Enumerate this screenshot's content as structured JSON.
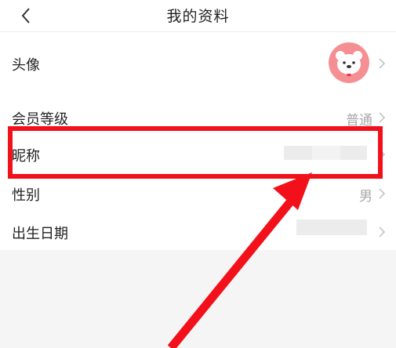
{
  "header": {
    "back_icon": "chevron-left-icon",
    "title": "我的资料"
  },
  "profile": {
    "rows": [
      {
        "label": "头像",
        "value": "",
        "icon": "avatar-bear-icon"
      },
      {
        "label": "会员等级",
        "value": "普通"
      },
      {
        "label": "昵称",
        "value": ""
      },
      {
        "label": "性别",
        "value": "男"
      },
      {
        "label": "出生日期",
        "value": ""
      }
    ],
    "chevron_icon": "chevron-right-icon"
  },
  "annotation": {
    "highlight_color": "#f2111a",
    "arrow_color": "#f2111a"
  },
  "colors": {
    "avatar_bg": "#f58f93",
    "page_bg": "#f5f5f5",
    "value_text": "#a8a8a8"
  }
}
